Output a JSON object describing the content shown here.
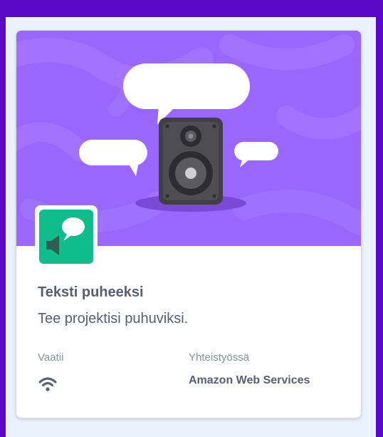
{
  "extension": {
    "name": "Teksti puheeksi",
    "description": "Tee projektisi puhuviksi.",
    "requires_label": "Vaatii",
    "requires_icon": "wifi-icon",
    "collaboration_label": "Yhteistyössä",
    "collaborator": "Amazon Web Services",
    "hero_image": "speaker-with-speech-bubbles",
    "icon": "speech-bubble-speaker-icon"
  },
  "colors": {
    "background": "#5c08c8",
    "hero": "#9966ff",
    "icon_tile": "#0fbd8c",
    "text": "#575e75",
    "muted_text": "#8a8fa0"
  }
}
